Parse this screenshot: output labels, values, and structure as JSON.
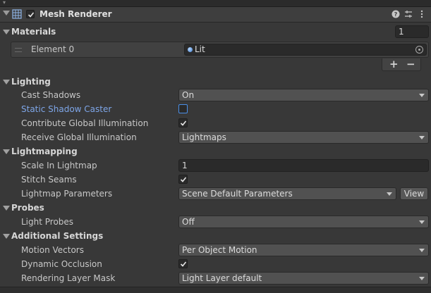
{
  "component": {
    "title": "Mesh Renderer",
    "enabled": true,
    "icons": [
      "help-icon",
      "presets-icon",
      "more-icon"
    ]
  },
  "materials": {
    "label": "Materials",
    "size": "1",
    "element_label": "Element 0",
    "element_value": "Lit",
    "add": "+",
    "remove": "−"
  },
  "lighting": {
    "label": "Lighting",
    "cast_shadows": {
      "label": "Cast Shadows",
      "value": "On"
    },
    "static_shadow_caster": {
      "label": "Static Shadow Caster",
      "checked": false
    },
    "contribute_gi": {
      "label": "Contribute Global Illumination",
      "checked": true
    },
    "receive_gi": {
      "label": "Receive Global Illumination",
      "value": "Lightmaps"
    }
  },
  "lightmapping": {
    "label": "Lightmapping",
    "scale": {
      "label": "Scale In Lightmap",
      "value": "1"
    },
    "stitch_seams": {
      "label": "Stitch Seams",
      "checked": true
    },
    "parameters": {
      "label": "Lightmap Parameters",
      "value": "Scene Default Parameters",
      "view": "View"
    }
  },
  "probes": {
    "label": "Probes",
    "light_probes": {
      "label": "Light Probes",
      "value": "Off"
    }
  },
  "additional": {
    "label": "Additional Settings",
    "motion_vectors": {
      "label": "Motion Vectors",
      "value": "Per Object Motion"
    },
    "dynamic_occlusion": {
      "label": "Dynamic Occlusion",
      "checked": true
    },
    "rendering_layer_mask": {
      "label": "Rendering Layer Mask",
      "value": "Light Layer default"
    }
  },
  "colors": {
    "background": "#383838",
    "accent": "#4a8fe8",
    "highlight_label": "#7ea6e8"
  }
}
